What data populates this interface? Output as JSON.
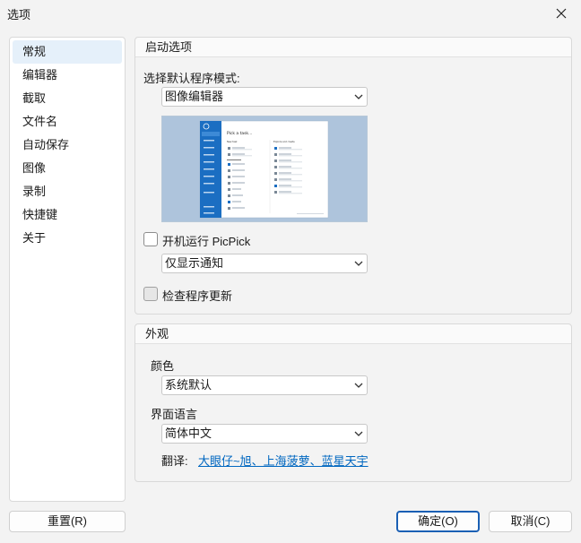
{
  "window": {
    "title": "选项"
  },
  "sidebar": {
    "items": [
      {
        "label": "常规",
        "active": true
      },
      {
        "label": "编辑器"
      },
      {
        "label": "截取"
      },
      {
        "label": "文件名"
      },
      {
        "label": "自动保存"
      },
      {
        "label": "图像"
      },
      {
        "label": "录制"
      },
      {
        "label": "快捷键"
      },
      {
        "label": "关于"
      }
    ]
  },
  "startup": {
    "header": "启动选项",
    "mode_label": "选择默认程序模式:",
    "mode_value": "图像编辑器",
    "autorun_label": "开机运行 PicPick",
    "autorun_checked": false,
    "notify_value": "仅显示通知",
    "update_label": "检查程序更新",
    "update_checked": false,
    "preview_window": {
      "heading": "Pick a task...",
      "column_left": "New task",
      "column_right": "Explore and create"
    }
  },
  "appearance": {
    "header": "外观",
    "color_label": "颜色",
    "color_value": "系统默认",
    "language_label": "界面语言",
    "language_value": "简体中文",
    "translation_label": "翻译:",
    "translators": "大眼仔~旭、上海菠萝、蓝星天宇"
  },
  "buttons": {
    "reset": "重置(R)",
    "ok": "确定(O)",
    "cancel": "取消(C)"
  },
  "colors": {
    "accent": "#1a5fb4",
    "link": "#0067c0",
    "preview_bg": "#aec4dc",
    "preview_sidebar": "#1b6ec2"
  }
}
